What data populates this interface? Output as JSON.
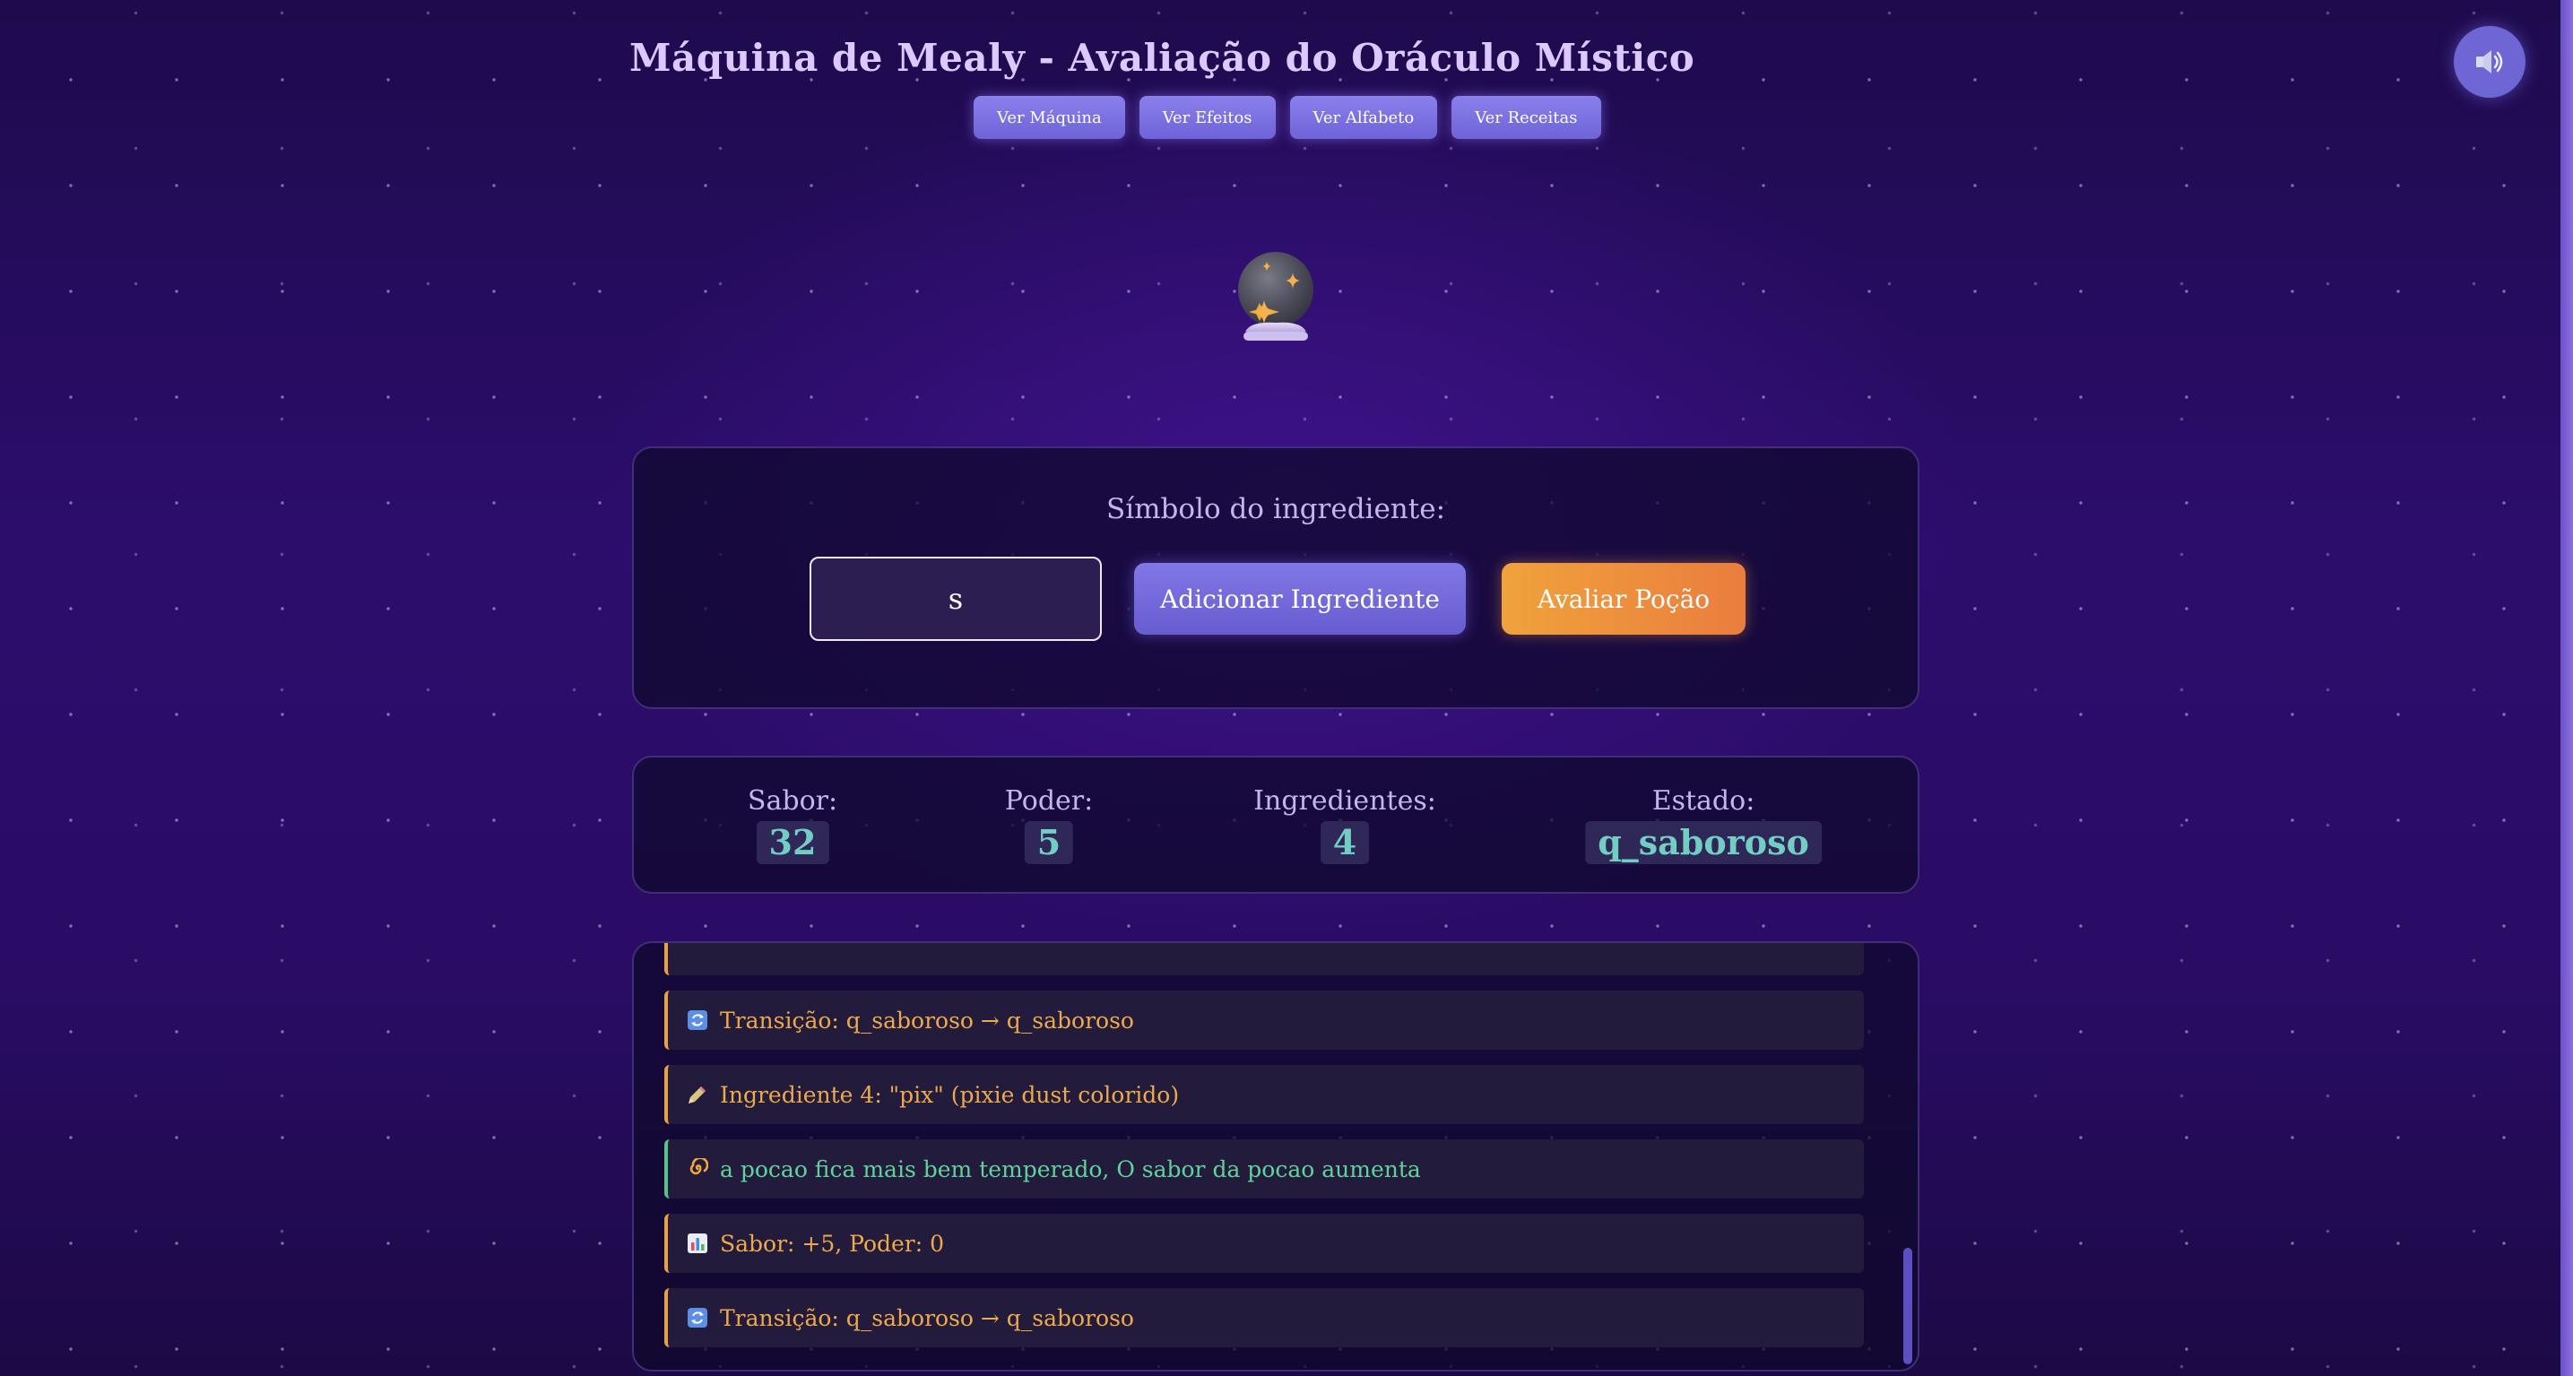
{
  "header": {
    "title": "Máquina de Mealy - Avaliação do Oráculo Místico",
    "nav": [
      {
        "label": "Ver Máquina"
      },
      {
        "label": "Ver Efeitos"
      },
      {
        "label": "Ver Alfabeto"
      },
      {
        "label": "Ver Receitas"
      }
    ],
    "sound_icon": "speaker-icon",
    "mascot_icon": "crystal-ball-icon"
  },
  "input_panel": {
    "label": "Símbolo do ingrediente:",
    "input_value": "s",
    "add_button": "Adicionar Ingrediente",
    "evaluate_button": "Avaliar Poção"
  },
  "stats": [
    {
      "label": "Sabor:",
      "value": "32"
    },
    {
      "label": "Poder:",
      "value": "5"
    },
    {
      "label": "Ingredientes:",
      "value": "4"
    },
    {
      "label": "Estado:",
      "value": "q_saboroso"
    }
  ],
  "log": [
    {
      "icon": "refresh-icon",
      "text": "",
      "kind": "orange"
    },
    {
      "icon": "refresh-icon",
      "text": "Transição: q_saboroso → q_saboroso",
      "kind": "orange"
    },
    {
      "icon": "pencil-icon",
      "text": "Ingrediente 4: \"pix\" (pixie dust colorido)",
      "kind": "orange"
    },
    {
      "icon": "swirl-icon",
      "text": "a pocao fica mais bem temperado, O sabor da pocao aumenta",
      "kind": "green"
    },
    {
      "icon": "bar-chart-icon",
      "text": "Sabor: +5, Poder: 0",
      "kind": "orange"
    },
    {
      "icon": "refresh-icon",
      "text": "Transição: q_saboroso → q_saboroso",
      "kind": "orange"
    }
  ],
  "colors": {
    "accent": "#7369dc",
    "orange": "#eda94a",
    "green": "#61d29a",
    "stat_value": "#72cdc3"
  }
}
